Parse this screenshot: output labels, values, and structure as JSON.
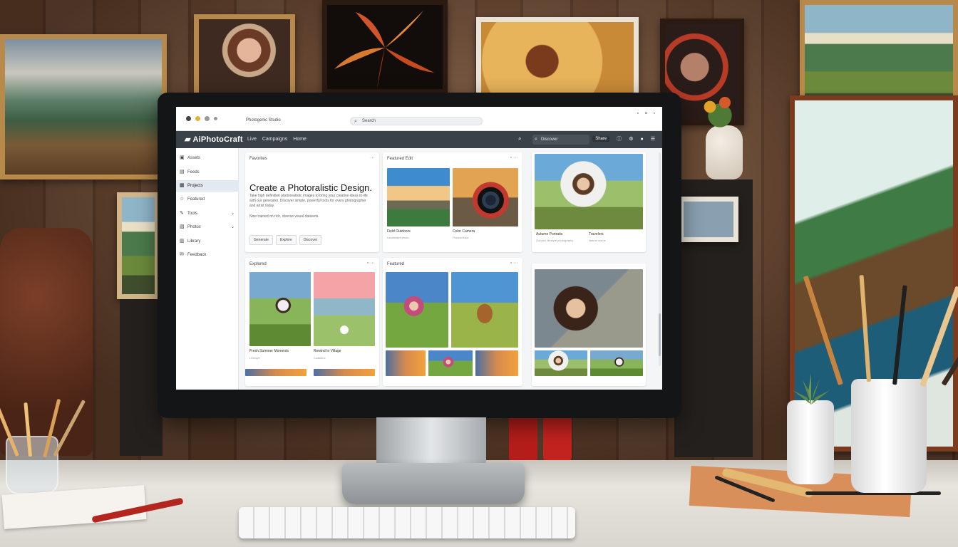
{
  "browser": {
    "title": "Photogenic Studio",
    "address": "Search"
  },
  "app": {
    "logo": "AiPhotoCraft",
    "nav": [
      "Live",
      "Campaigns",
      "Home"
    ],
    "search": "Discover",
    "share_label": "Share"
  },
  "sidebar": {
    "items": [
      {
        "label": "Assets",
        "icon": "home-icon"
      },
      {
        "label": "Feeds",
        "icon": "feed-icon"
      },
      {
        "label": "Projects",
        "icon": "project-icon",
        "active": true
      },
      {
        "label": "Featured",
        "icon": "star-icon"
      },
      {
        "label": "Tools",
        "icon": "tools-icon",
        "chevron": true
      },
      {
        "label": "Photos",
        "icon": "photo-icon",
        "chevron": true
      },
      {
        "label": "Library",
        "icon": "library-icon"
      },
      {
        "label": "Feedback",
        "icon": "feedback-icon"
      }
    ]
  },
  "hero": {
    "label": "Favorites",
    "title": "Create a Photoralistic Design.",
    "text": "Take high definition photorealistic images to bring your creative ideas to life with our generator. Discover simple, powerful tools for every photographer and artist today.",
    "note": "Now trained on rich, diverse visual datasets.",
    "buttons": [
      "Generate",
      "Explore",
      "Discover"
    ]
  },
  "featured": {
    "label": "Featured Edit",
    "captions": [
      "Field Outdoors",
      "Color Camera"
    ],
    "subs": [
      "Landscape photo",
      "Product shot"
    ]
  },
  "portrait_card": {
    "captions": [
      "Autumn Portraits",
      "Travelers"
    ],
    "subs": [
      "Outdoor lifestyle photography",
      "Nature scene"
    ]
  },
  "row2_left": {
    "label": "Explored",
    "captions": [
      "Fresh Summer Moments",
      "Rewind to Village"
    ],
    "subs": [
      "Lifestyle",
      "Coastline"
    ]
  },
  "row2_mid": {
    "label": "Featured"
  }
}
